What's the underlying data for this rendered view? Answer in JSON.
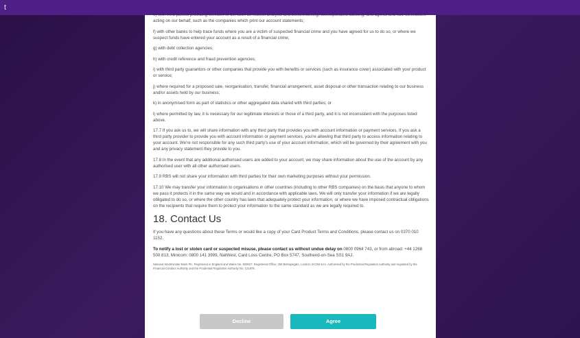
{
  "topbar": {
    "label": "t"
  },
  "terms": {
    "items": [
      "e) with third parties providing services to us, such as market analysis and benchmarking, correspondent banking, and agents and sub-contractors acting on our behalf, such as the companies which print our account statements;",
      "f) with other banks to help trace funds where you are a victim of suspected financial crime and you have agreed for us to do so, or where we suspect funds have entered your account as a result of a financial crime;",
      "g) with debt collection agencies;",
      "h) with credit reference and fraud prevention agencies;",
      "i) with third party guarantors or other companies that provide you with benefits or services (such as insurance cover) associated with your product or service;",
      "j) where required for a proposed sale, reorganisation, transfer, financial arrangement, asset disposal or other transaction relating to our business and/or assets held by our business;",
      "k) in anonymised form as part of statistics or other aggregated data shared with third parties; or",
      "l) where permitted by law, it is necessary for our legitimate interests or those of a third party, and it is not inconsistent with the purposes listed above.",
      "17.7 If you ask us to, we will share information with any third party that provides you with account information or payment services. If you ask a third party provider to provide you with account information or payment services, you're allowing that third party to access information relating to your account. We're not responsible for any such third party's use of your account information, which will be governed by their agreement with you and any privacy statement they provide to you.",
      "17.8 In the event that any additional authorised users are added to your account, we may share information about the use of the account by any authorised user with all other authorised users.",
      "17.9 RBS will not share your information with third parties for their own marketing purposes without your permission.",
      "17.10 We may transfer your information to organisations in other countries (including to other RBS companies) on the basis that anyone to whom we pass it protects it in the same way we would and in accordance with applicable laws. We will only transfer your information if we are legally obligated to do so, or where the other country has laws that adequately protect your information, or where we have imposed contractual obligations on the recipients that require them to protect your information to the same standard as we are legally required to."
    ],
    "section_heading": "18. Contact Us",
    "contact_text": "If you have any questions about these Terms or would like a copy of your Card Product Terms and Conditions, please contact us on 0370 010 1152.",
    "lost_card_bold": "To notify a lost or stolen card or suspected misuse, please contact us without undue delay on",
    "lost_card_rest": " 0800 0964 743, or from abroad: +44 1268 500 813, Minicom: 0800 141 3999, NatWest, Card Loss Centre, PO Box 5747, Southend-on-Sea SS1 9AJ.",
    "legal_small": "National Westminster Bank Plc. Registered in England and Wales No. 929027. Registered Office: 250 Bishopsgate, London, EC2M 4AA. Authorised by the Prudential Regulation Authority and regulated by the Financial Conduct Authority and the Prudential Regulation Authority No. 121878."
  },
  "buttons": {
    "decline": "Decline",
    "agree": "Agree"
  },
  "colors": {
    "topbar": "#4d1f87",
    "agree": "#1ab7bc",
    "decline": "#c8c8c8"
  }
}
